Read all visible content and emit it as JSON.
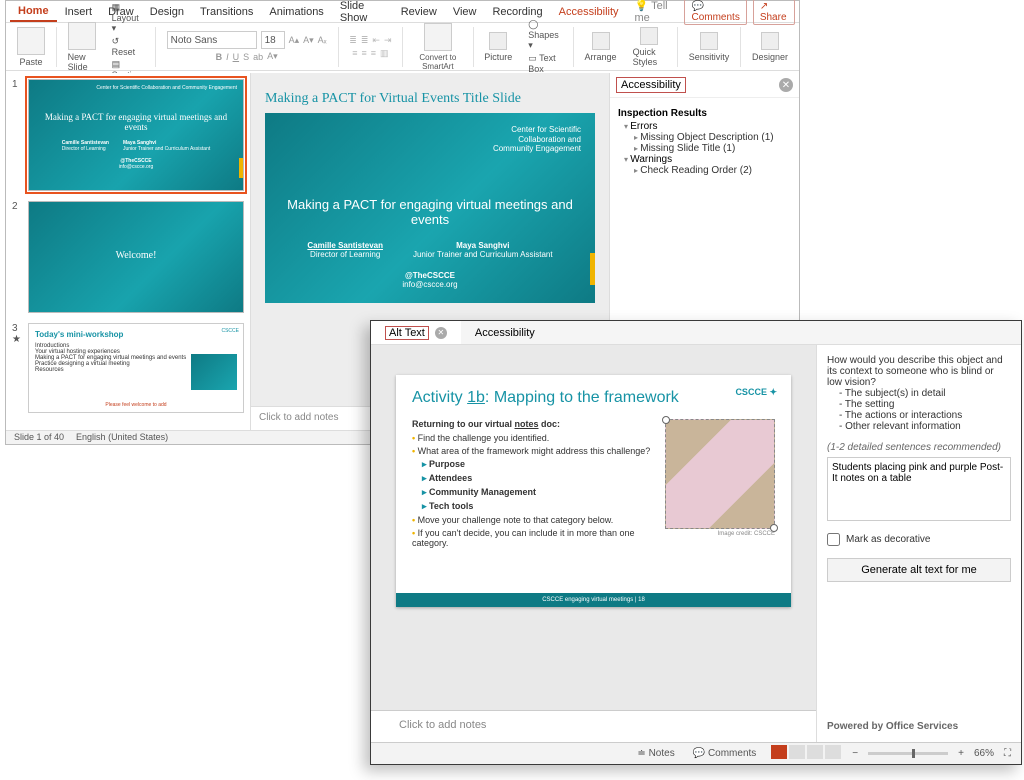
{
  "back": {
    "tabs": [
      "Home",
      "Insert",
      "Draw",
      "Design",
      "Transitions",
      "Animations",
      "Slide Show",
      "Review",
      "View",
      "Recording",
      "Accessibility",
      "Tell me"
    ],
    "active_tab": "Home",
    "comments_btn": "Comments",
    "share_btn": "Share",
    "ribbon": {
      "paste": "Paste",
      "new_slide": "New Slide",
      "layout": "Layout",
      "reset": "Reset",
      "section": "Section",
      "font_name": "Noto Sans",
      "font_size": "18",
      "convert": "Convert to SmartArt",
      "picture": "Picture",
      "shapes": "Shapes",
      "textbox": "Text Box",
      "arrange": "Arrange",
      "quickstyles": "Quick Styles",
      "sensitivity": "Sensitivity",
      "designer": "Designer"
    },
    "thumbs": {
      "t1": {
        "legend": "Center for Scientific Collaboration and Community Engagement",
        "title": "Making a PACT for engaging virtual meetings and events",
        "name1": "Camille Santistevan",
        "role1": "Director of Learning",
        "name2": "Maya Sanghvi",
        "role2": "Junior Trainer and Curriculum Assistant",
        "handle": "@TheCSCCE",
        "email": "info@cscce.org"
      },
      "t2_title": "Welcome!",
      "t3": {
        "title": "Today's mini-workshop",
        "logo": "CSCCE",
        "items": [
          "Introductions",
          "Your virtual hosting experiences",
          "Making a PACT for engaging virtual meetings and events",
          "Practice designing a virtual meeting",
          "Resources"
        ],
        "footer": "Please feel welcome to add"
      }
    },
    "editor": {
      "caption": "Making a PACT for Virtual Events Title Slide",
      "slide": {
        "legend1": "Center for Scientific",
        "legend2": "Collaboration and",
        "legend3": "Community Engagement",
        "title": "Making a PACT for engaging virtual meetings and events",
        "name1": "Camille Santistevan",
        "role1": "Director of Learning",
        "name2": "Maya Sanghvi",
        "role2": "Junior Trainer and Curriculum Assistant",
        "handle": "@TheCSCCE",
        "email": "info@cscce.org"
      },
      "notes_placeholder": "Click to add notes"
    },
    "acc": {
      "title": "Accessibility",
      "inspection": "Inspection Results",
      "errors": "Errors",
      "e1": "Missing Object Description (1)",
      "e2": "Missing Slide Title (1)",
      "warnings": "Warnings",
      "w1": "Check Reading Order (2)"
    },
    "status": {
      "slide": "Slide 1 of 40",
      "lang": "English (United States)"
    }
  },
  "front": {
    "tabs": {
      "alt": "Alt Text",
      "acc": "Accessibility"
    },
    "slide": {
      "title_pre": "Activity ",
      "title_num": "1b",
      "title_post": ": Mapping to the framework",
      "logo": "CSCCE",
      "lead_pre": "Returning to our virtual ",
      "lead_link": "notes",
      "lead_post": " doc:",
      "b1": "Find the challenge you identified.",
      "b2": "What area of the framework might address this challenge?",
      "s1": "Purpose",
      "s2": "Attendees",
      "s3": "Community Management",
      "s4": "Tech tools",
      "b3": "Move your challenge note to that category below.",
      "b4": "If you can't decide, you can include it in more than one category.",
      "credit": "Image credit: CSCCE",
      "footer": "CSCCE engaging virtual meetings  |  18"
    },
    "notes_placeholder": "Click to add notes",
    "alt": {
      "question": "How would you describe this object and its context to someone who is blind or low vision?",
      "q1": "- The subject(s) in detail",
      "q2": "- The setting",
      "q3": "- The actions or interactions",
      "q4": "- Other relevant information",
      "hint": "(1-2 detailed sentences recommended)",
      "value": "Students placing pink and purple Post-It notes on a table",
      "decorative": "Mark as decorative",
      "generate": "Generate alt text for me",
      "powered": "Powered by Office Services"
    },
    "status": {
      "notes": "Notes",
      "comments": "Comments",
      "zoom": "66%"
    }
  }
}
